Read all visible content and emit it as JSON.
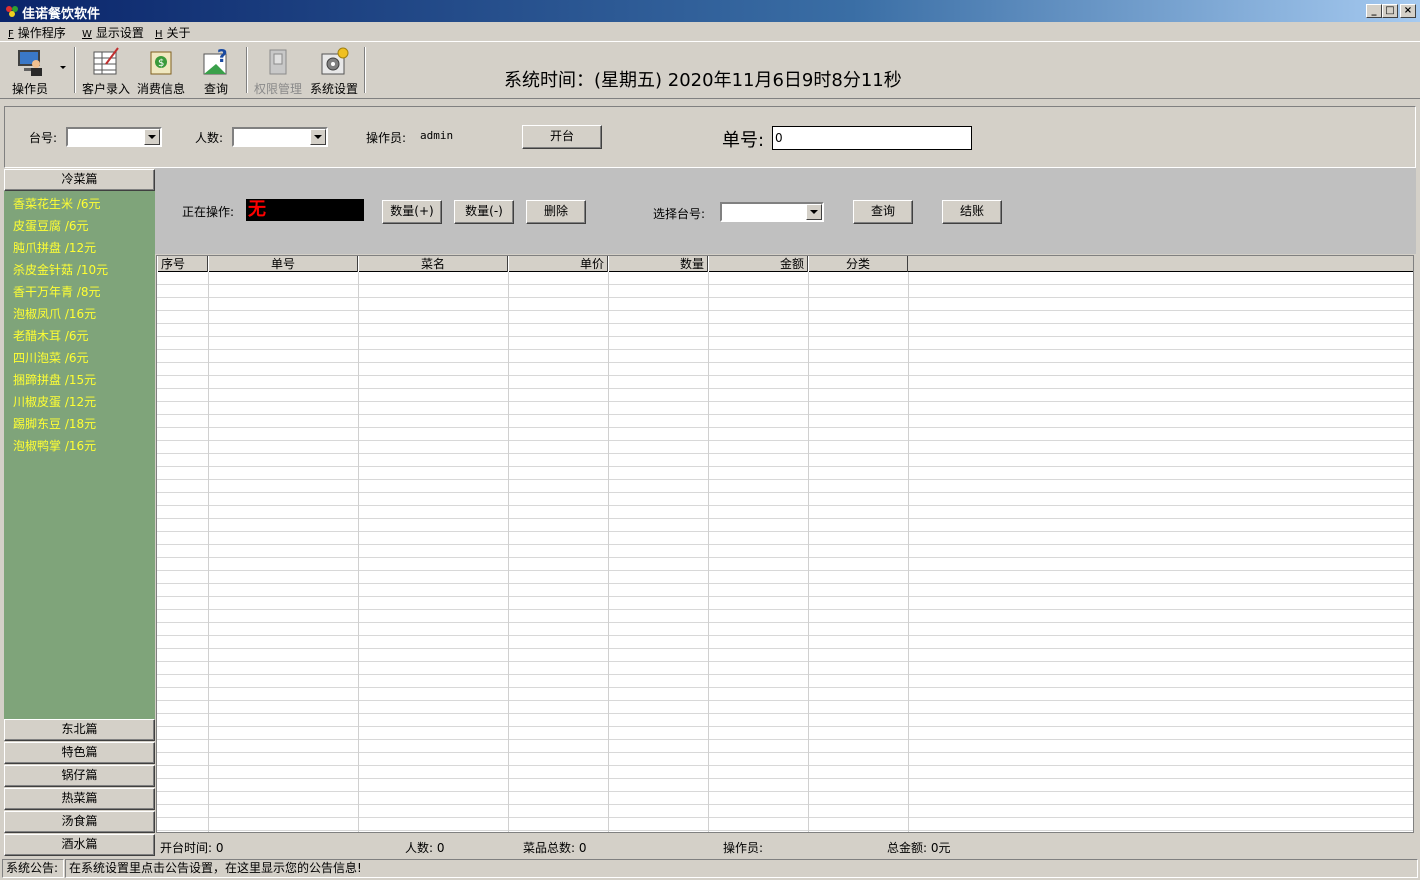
{
  "window": {
    "title": "佳诺餐饮软件"
  },
  "menu": [
    {
      "accel": "F",
      "label": "操作程序"
    },
    {
      "accel": "W",
      "label": "显示设置"
    },
    {
      "accel": "H",
      "label": "关于"
    }
  ],
  "toolbar": {
    "operator": "操作员",
    "customer_entry": "客户录入",
    "consumption_info": "消费信息",
    "query": "查询",
    "permissions": "权限管理",
    "system_settings": "系统设置"
  },
  "system_time": "系统时间：(星期五) 2020年11月6日9时8分11秒",
  "info": {
    "table_label": "台号:",
    "people_label": "人数:",
    "operator_label": "操作员:",
    "operator_value": "admin",
    "open_table_button": "开台",
    "order_no_label": "单号:",
    "order_no_value": "0"
  },
  "categories": {
    "top": "冷菜篇",
    "bottom": [
      "东北篇",
      "特色篇",
      "锅仔篇",
      "热菜篇",
      "汤食篇",
      "酒水篇"
    ]
  },
  "dishes": [
    "香菜花生米 /6元",
    "皮蛋豆腐 /6元",
    "肫爪拼盘 /12元",
    "杀皮金针菇 /10元",
    "香干万年青 /8元",
    "泡椒凤爪 /16元",
    "老醋木耳 /6元",
    "四川泡菜 /6元",
    "捆蹄拼盘 /15元",
    "川椒皮蛋 /12元",
    "踢脚东豆 /18元",
    "泡椒鸭掌 /16元"
  ],
  "operation": {
    "current_label": "正在操作:",
    "current_value": "无",
    "qty_plus": "数量(+)",
    "qty_minus": "数量(-)",
    "delete": "删除",
    "select_table_label": "选择台号:",
    "query": "查询",
    "checkout": "结账"
  },
  "grid": {
    "columns": [
      "序号",
      "单号",
      "菜名",
      "单价",
      "数量",
      "金额",
      "分类"
    ]
  },
  "stats": {
    "open_time": "开台时间: 0",
    "people": "人数: 0",
    "dish_total": "菜品总数: 0",
    "operator": "操作员:",
    "total_amount": "总金额: 0元"
  },
  "notice": {
    "label": "系统公告:",
    "text": "在系统设置里点击公告设置，在这里显示您的公告信息!"
  },
  "colors": {
    "title_bar": "#0a246a",
    "category_panel": "#7fa47a",
    "dish_text": "#ffff33",
    "current_op_text": "#ff0000"
  }
}
